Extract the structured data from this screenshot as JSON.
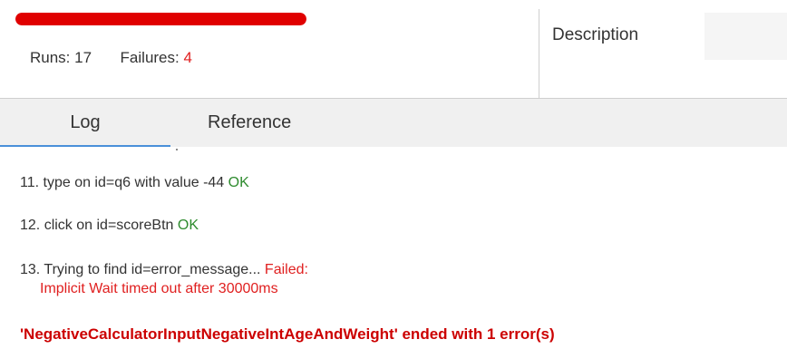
{
  "progress": {
    "fraction": 1.0,
    "color": "#e00000"
  },
  "stats": {
    "runs_label": "Runs:",
    "runs_value": "17",
    "failures_label": "Failures:",
    "failures_value": "4"
  },
  "description": {
    "label": "Description"
  },
  "tabs": [
    {
      "label": "Log",
      "active": true
    },
    {
      "label": "Reference",
      "active": false
    }
  ],
  "log": {
    "entries": [
      {
        "text": "11. type on id=q6 with value -44",
        "status": "OK"
      },
      {
        "text": "12. click on id=scoreBtn",
        "status": "OK"
      },
      {
        "text": "13. Trying to find id=error_message...",
        "status": "Failed:",
        "detail": "Implicit Wait timed out after 30000ms"
      }
    ],
    "summary": "'NegativeCalculatorInputNegativeIntAgeAndWeight' ended with 1 error(s)"
  },
  "colors": {
    "ok": "#2e8b2e",
    "failed": "#e02020",
    "accent": "#4a90d9"
  }
}
